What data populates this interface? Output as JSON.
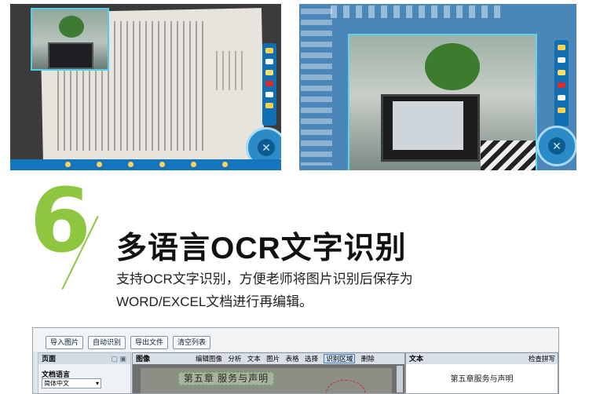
{
  "heading": {
    "number": "6",
    "title": "多语言OCR文字识别",
    "line1": "支持OCR文字识别，方便老师将图片识别后保存为",
    "line2": "WORD/EXCEL文档进行再编辑。"
  },
  "app": {
    "toolbar": [
      "导入图片",
      "自动识别",
      "导出文件",
      "清空列表"
    ],
    "side_panel": {
      "title": "页面",
      "language_label": "文档语言",
      "language_value": "简体中文"
    },
    "image_panel": {
      "title": "图像",
      "tools": [
        "编辑图像",
        "分析",
        "文本",
        "图片",
        "表格",
        "选择",
        "识别区域",
        "删除"
      ],
      "selected_tool": "识别区域",
      "doc_heading": "第五章 服务与声明"
    },
    "text_panel": {
      "title": "文本",
      "check_label": "检查拼写",
      "recognized_text": "第五章服务与声明"
    }
  },
  "colors": {
    "accent_green": "#8ec63f",
    "toolbar_blue": "#1676bd"
  }
}
